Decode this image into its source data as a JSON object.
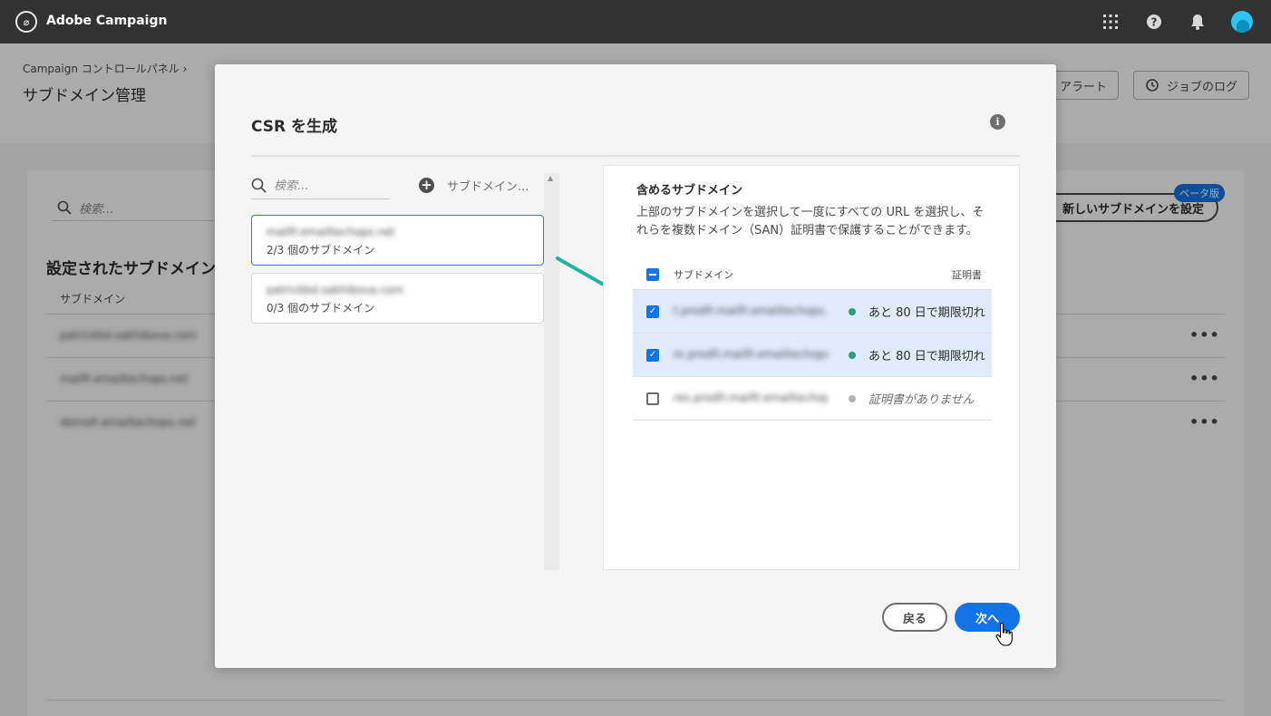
{
  "topbar": {
    "app_title": "Adobe Campaign",
    "icons": [
      "apps-icon",
      "help-icon",
      "bell-icon",
      "avatar"
    ]
  },
  "page": {
    "breadcrumb": "Campaign コントロールパネル",
    "title": "サブドメイン管理",
    "alert_button": "アラート",
    "job_log_button": "ジョブのログ",
    "search_placeholder": "検索...",
    "new_subdomain_button": "新しいサブドメインを設定",
    "beta_badge": "ベータ版",
    "section_title": "設定されたサブドメイン",
    "column_subdomain": "サブドメイン",
    "rows": [
      "patrickbd.sakhibova.com",
      "mailfr.emailtechops.net",
      "demofr.emailtechops.net"
    ]
  },
  "modal": {
    "title": "CSR を生成",
    "search_placeholder": "検索...",
    "add_label": "サブドメイン...",
    "domains": [
      {
        "name": "mailfr.emailtechops.net",
        "count": "2/3 個のサブドメイン",
        "selected": true
      },
      {
        "name": "patrickbd.sakhibova.com",
        "count": "0/3 個のサブドメイン",
        "selected": false
      }
    ],
    "panel": {
      "title": "含めるサブドメイン",
      "description": "上部のサブドメインを選択して一度にすべての URL を選択し、それらを複数ドメイン（SAN）証明書で保護することができます。",
      "col_subdomain": "サブドメイン",
      "col_certificate": "証明書",
      "rows": [
        {
          "name": "t.prodfr.mailfr.emailtechops.net",
          "status": "あと 80 日で期限切れ",
          "checked": true
        },
        {
          "name": "m.prodfr.mailfr.emailtechops.net",
          "status": "あと 80 日で期限切れ",
          "checked": true
        },
        {
          "name": "res.prodfr.mailfr.emailtechops.net",
          "status": "証明書がありません",
          "checked": false
        }
      ]
    },
    "back_button": "戻る",
    "next_button": "次へ"
  },
  "colors": {
    "accent": "#1473e6",
    "status_ok": "#2d9d78",
    "status_none": "#b3b3b3",
    "arrow": "#1fb5a1"
  }
}
